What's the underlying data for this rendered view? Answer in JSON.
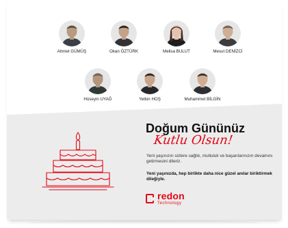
{
  "people": [
    {
      "name": "Ahmet GÜMÜŞ",
      "skin": "#b99a7e",
      "hair": "#5b5045",
      "shirt": "#3a3f47"
    },
    {
      "name": "Okan ÖZTÜRK",
      "skin": "#c5a28a",
      "hair": "#2b2622",
      "shirt": "#303236"
    },
    {
      "name": "Melisa BULUT",
      "skin": "#e3c3b0",
      "hair": "#4a2c20",
      "shirt": "#1f1f22"
    },
    {
      "name": "Mesut DENİZCİ",
      "skin": "#cfae96",
      "hair": "#6d655d",
      "shirt": "#3b3c40"
    },
    {
      "name": "Hüseyin UYAĞ",
      "skin": "#b4967c",
      "hair": "#6e6660",
      "shirt": "#2f3a35"
    },
    {
      "name": "Yetkin HOŞ",
      "skin": "#c8a48a",
      "hair": "#2e2a27",
      "shirt": "#25272b"
    },
    {
      "name": "Muhammet BİLGİN",
      "skin": "#d0ad92",
      "hair": "#3a3430",
      "shirt": "#2d2f34"
    }
  ],
  "heading": {
    "line1": "Doğum Gününüz",
    "line2": "Kutlu Olsun!"
  },
  "message": {
    "body": "Yeni yaşınızın sizlere sağlık, mutluluk ve başarılarınızın devamını getirmesini dileriz.",
    "wish": "Yeni yaşınızda, hep birlikte daha nice güzel anılar biriktirmek dileğiyle."
  },
  "logo": {
    "name": "redon",
    "sub": "Technology"
  },
  "colors": {
    "accent": "#e30613",
    "panel": "#ececec"
  },
  "icons": {
    "cake": "birthday-cake-icon",
    "logo": "redon-logo-icon"
  }
}
